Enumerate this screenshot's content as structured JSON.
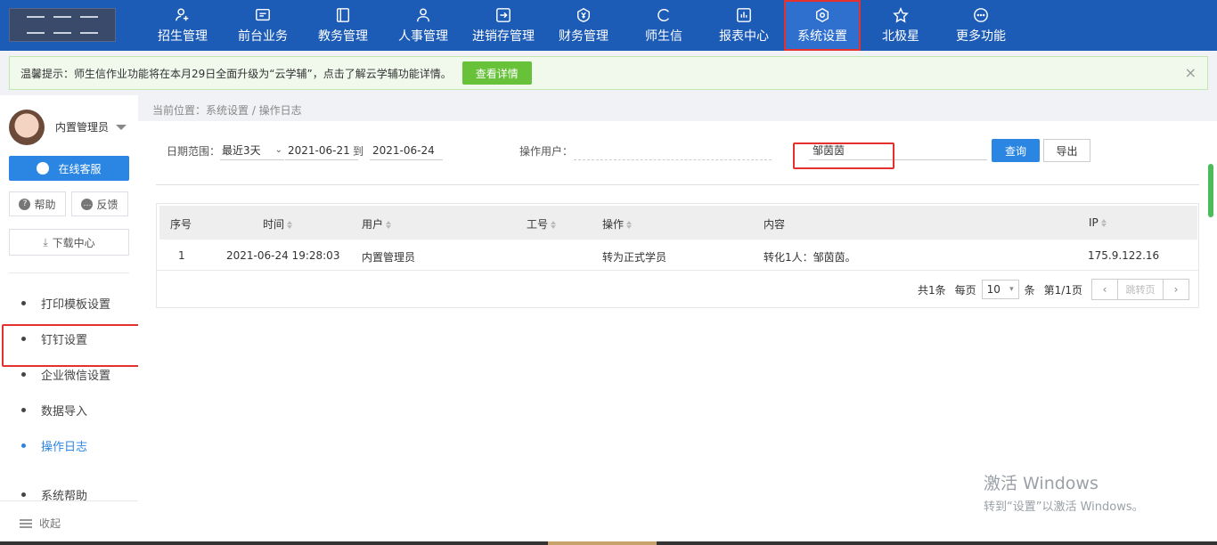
{
  "nav": {
    "items": [
      {
        "label": "招生管理",
        "icon": "user-add-icon"
      },
      {
        "label": "前台业务",
        "icon": "monitor-icon"
      },
      {
        "label": "教务管理",
        "icon": "book-icon"
      },
      {
        "label": "人事管理",
        "icon": "person-icon"
      },
      {
        "label": "进销存管理",
        "icon": "enter-box-icon"
      },
      {
        "label": "财务管理",
        "icon": "yuan-shield-icon"
      },
      {
        "label": "师生信",
        "icon": "chat-icon"
      },
      {
        "label": "报表中心",
        "icon": "chart-icon"
      },
      {
        "label": "系统设置",
        "icon": "settings-icon"
      },
      {
        "label": "北极星",
        "icon": "star-icon"
      },
      {
        "label": "更多功能",
        "icon": "more-icon"
      }
    ],
    "active": "系统设置"
  },
  "notice": {
    "text": "温馨提示：师生信作业功能将在本月29日全面升级为“云学辅”，点击了解云学辅功能详情。",
    "button": "查看详情",
    "close": "×"
  },
  "sidebar": {
    "user": "内置管理员",
    "service_button": "在线客服",
    "help_button": "帮助",
    "feedback_button": "反馈",
    "download_button": "下载中心",
    "menu": [
      {
        "label": "打印模板设置"
      },
      {
        "label": "钉钉设置"
      },
      {
        "label": "企业微信设置"
      },
      {
        "label": "数据导入"
      },
      {
        "label": "操作日志"
      },
      {
        "label": "系统帮助"
      }
    ],
    "collapse": "收起"
  },
  "breadcrumb": "当前位置：系统设置 / 操作日志",
  "filters": {
    "date_label": "日期范围：",
    "range": "最近3天",
    "start": "2021-06-21",
    "to": "到",
    "end": "2021-06-24",
    "user_label": "操作用户：",
    "name": "邹茵茵",
    "query_button": "查询",
    "export_button": "导出"
  },
  "table": {
    "columns": [
      "序号",
      "时间",
      "用户",
      "工号",
      "操作",
      "内容",
      "IP"
    ],
    "rows": [
      {
        "no": "1",
        "time": "2021-06-24 19:28:03",
        "user": "内置管理员",
        "staff_id": "",
        "op": "转为正式学员",
        "content": "转化1人：邹茵茵。",
        "ip": "175.9.122.16"
      }
    ]
  },
  "pager": {
    "total": "共1条",
    "per_page_label": "每页",
    "size": "10",
    "unit": "条",
    "page": "第1/1页",
    "jump": "跳转页"
  },
  "watermark": {
    "line1": "激活 Windows",
    "line2": "转到“设置”以激活 Windows。"
  }
}
